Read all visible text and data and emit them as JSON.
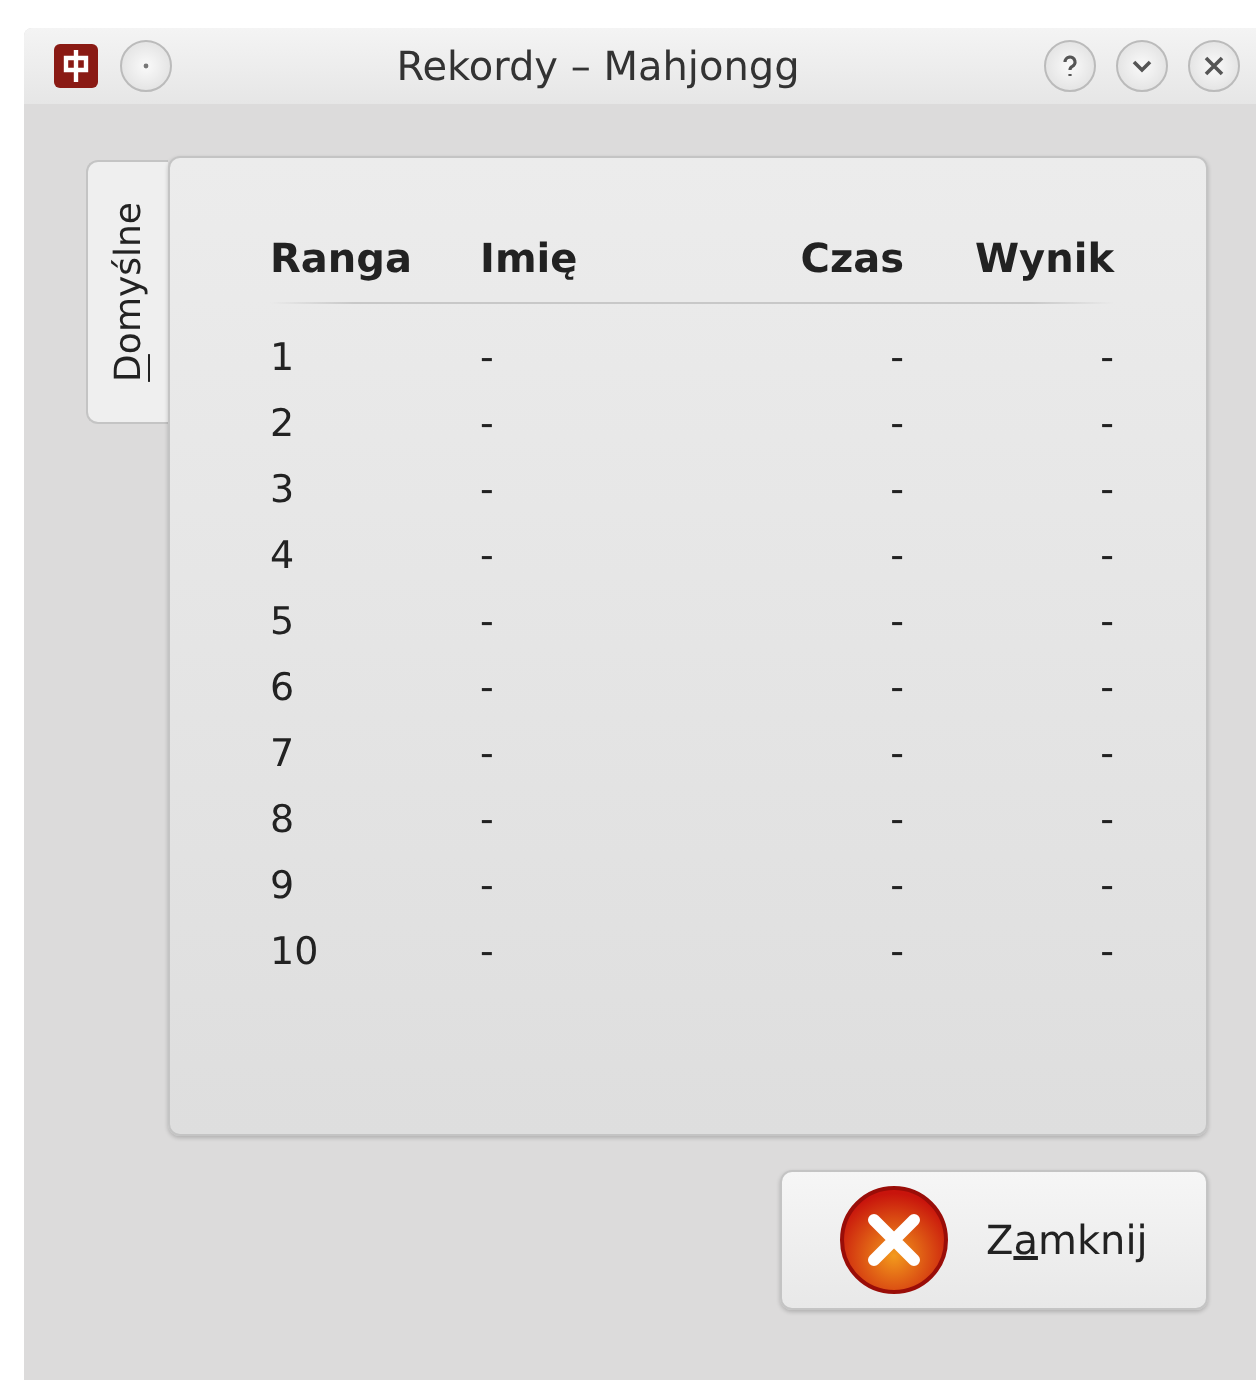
{
  "window": {
    "title": "Rekordy – Mahjongg"
  },
  "tabs": [
    {
      "label": {
        "mnemonic": "D",
        "rest": "omyślne"
      },
      "selected": true
    }
  ],
  "table": {
    "columns": [
      "Ranga",
      "Imię",
      "Czas",
      "Wynik"
    ],
    "rows": [
      [
        "1",
        "-",
        "-",
        "-"
      ],
      [
        "2",
        "-",
        "-",
        "-"
      ],
      [
        "3",
        "-",
        "-",
        "-"
      ],
      [
        "4",
        "-",
        "-",
        "-"
      ],
      [
        "5",
        "-",
        "-",
        "-"
      ],
      [
        "6",
        "-",
        "-",
        "-"
      ],
      [
        "7",
        "-",
        "-",
        "-"
      ],
      [
        "8",
        "-",
        "-",
        "-"
      ],
      [
        "9",
        "-",
        "-",
        "-"
      ],
      [
        "10",
        "-",
        "-",
        "-"
      ]
    ]
  },
  "buttons": [
    {
      "label": {
        "before": "Z",
        "mnemonic": "a",
        "rest": "mknij"
      }
    }
  ]
}
